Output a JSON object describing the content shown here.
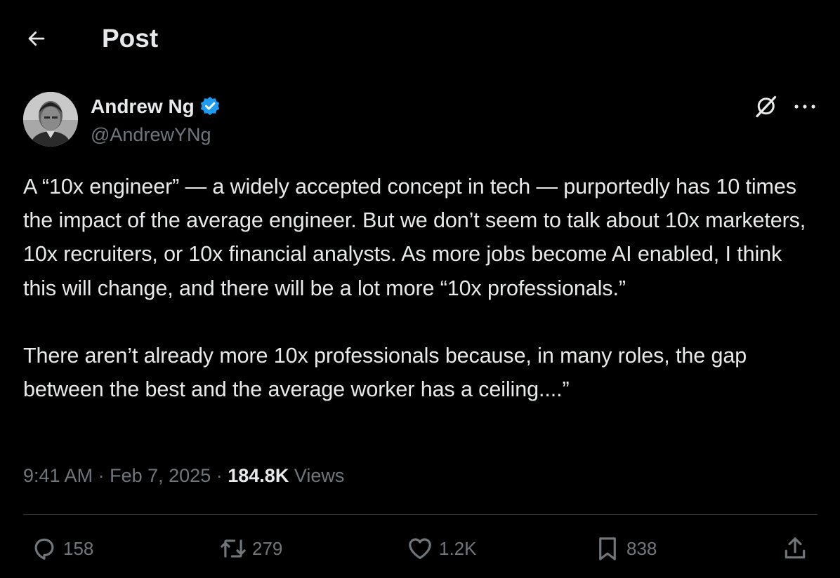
{
  "header": {
    "title": "Post",
    "back_icon": "arrow-left-icon"
  },
  "author": {
    "name": "Andrew Ng",
    "handle": "@AndrewYNg",
    "verified": true,
    "verified_color": "#1d9bf0"
  },
  "post": {
    "text": "A “10x engineer” — a widely accepted concept in tech — purportedly has 10 times the impact of the average engineer. But we don’t seem to talk about 10x marketers, 10x recruiters, or 10x financial analysts. As more jobs become AI enabled, I think this will change, and there will be a lot more “10x professionals.”\n\nThere aren’t already more 10x professionals because, in many roles, the gap between the best and the average worker has a ceiling....”"
  },
  "meta": {
    "time": "9:41 AM",
    "separator": "·",
    "date": "Feb 7, 2025",
    "views_count": "184.8K",
    "views_label": "Views"
  },
  "actions": {
    "replies": "158",
    "reposts": "279",
    "likes": "1.2K",
    "bookmarks": "838"
  },
  "colors": {
    "background": "#000000",
    "text_primary": "#e7e9ea",
    "text_secondary": "#71767b",
    "divider": "#2f3336"
  }
}
